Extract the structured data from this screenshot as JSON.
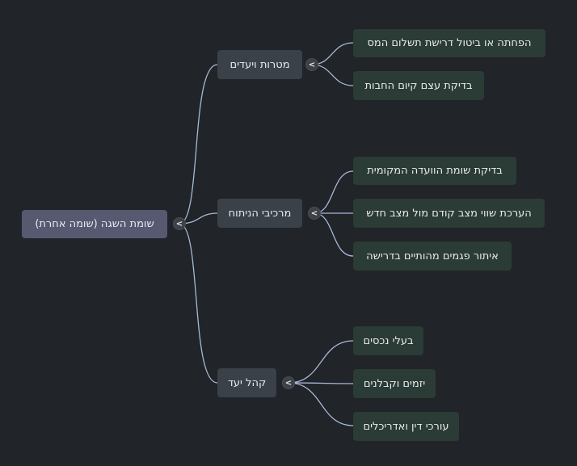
{
  "colors": {
    "background": "#212428",
    "root_fill": "#565970",
    "branch_fill": "#3b4149",
    "leaf_fill": "#2b3b36",
    "connector": "#a8b8d8"
  },
  "root": {
    "label": "שומת השגה (שומה אחרת)",
    "toggle": "<"
  },
  "branches": [
    {
      "label": "מטרות ויעדים",
      "toggle": "<",
      "children": [
        "הפחתה או ביטול דרישת תשלום המס",
        "בדיקת עצם קיום החבות"
      ]
    },
    {
      "label": "מרכיבי הניתוח",
      "toggle": "<",
      "children": [
        "בדיקת שומת הוועדה המקומית",
        "הערכת שווי מצב קודם מול מצב חדש",
        "איתור פגמים מהותיים בדרישה"
      ]
    },
    {
      "label": "קהל יעד",
      "toggle": "<",
      "children": [
        "בעלי נכסים",
        "יזמים וקבלנים",
        "עורכי דין ואדריכלים"
      ]
    }
  ]
}
